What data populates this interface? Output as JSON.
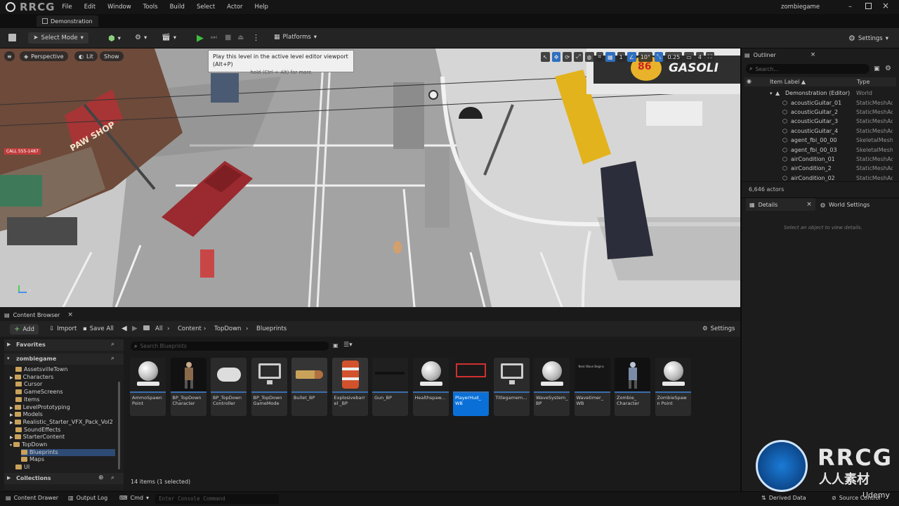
{
  "app": {
    "brand": "RRCG",
    "project": "zombiegame",
    "level": "Demonstration"
  },
  "menu": [
    "File",
    "Edit",
    "Window",
    "Tools",
    "Build",
    "Select",
    "Actor",
    "Help"
  ],
  "toolbar": {
    "select_mode": "Select Mode",
    "platforms": "Platforms",
    "settings": "Settings"
  },
  "viewport": {
    "perspective": "Perspective",
    "lit": "Lit",
    "show": "Show",
    "grid_snap": "1",
    "rot_snap": "10°",
    "scale_snap": "0.25",
    "cam_speed": "4",
    "tooltip_title": "Play this level in the active level editor viewport (Alt+P)",
    "tooltip_hint": "hold (Ctrl + Alt) for more",
    "sign_paw": "PAW SHOP",
    "sign_gas": "GASOLI",
    "sign_86": "86",
    "sign_call": "CALL 555-1487"
  },
  "outliner": {
    "tab": "Outliner",
    "search_placeholder": "Search...",
    "col_label": "Item Label ▲",
    "col_type": "Type",
    "root_label": "Demonstration (Editor)",
    "root_type": "World",
    "rows": [
      {
        "label": "acousticGuitar_01",
        "type": "StaticMeshActor"
      },
      {
        "label": "acousticGuitar_2",
        "type": "StaticMeshActor"
      },
      {
        "label": "acousticGuitar_3",
        "type": "StaticMeshActor"
      },
      {
        "label": "acousticGuitar_4",
        "type": "StaticMeshActor"
      },
      {
        "label": "agent_fbi_00_00",
        "type": "SkeletalMeshActor"
      },
      {
        "label": "agent_fbi_00_03",
        "type": "SkeletalMeshActor"
      },
      {
        "label": "airCondition_01",
        "type": "StaticMeshActor"
      },
      {
        "label": "airCondition_2",
        "type": "StaticMeshActor"
      },
      {
        "label": "airCondition_02",
        "type": "StaticMeshActor"
      }
    ],
    "actor_count": "6,646 actors"
  },
  "details": {
    "tab": "Details",
    "world_settings": "World Settings",
    "empty": "Select an object to view details."
  },
  "content_browser": {
    "tab": "Content Browser",
    "add": "Add",
    "import": "Import",
    "save_all": "Save All",
    "path": [
      "All",
      "Content",
      "TopDown",
      "Blueprints"
    ],
    "settings": "Settings",
    "favorites": "Favorites",
    "root": "zombiegame",
    "folders": [
      "AssetsvilleTown",
      "Characters",
      "Cursor",
      "GameScreens",
      "Items",
      "LevelPrototyping",
      "Models",
      "Realistic_Starter_VFX_Pack_Vol2",
      "SoundEffects",
      "StarterContent",
      "TopDown",
      "Blueprints",
      "Maps",
      "UI"
    ],
    "collections": "Collections",
    "search_placeholder": "Search Blueprints",
    "assets": [
      {
        "name": "AmmoSpawn Point"
      },
      {
        "name": "BP_TopDown Character"
      },
      {
        "name": "BP_TopDown Controller"
      },
      {
        "name": "BP_TopDown GameMode"
      },
      {
        "name": "Bullet_BP"
      },
      {
        "name": "Explosivebarrel _BP"
      },
      {
        "name": "Gun_BP"
      },
      {
        "name": "Healthspaw..."
      },
      {
        "name": "PlayerHud_ WB"
      },
      {
        "name": "Titlegamem..."
      },
      {
        "name": "WaveSystem_ BP"
      },
      {
        "name": "Wavetimer_ WB"
      },
      {
        "name": "Zombie_ Character"
      },
      {
        "name": "ZombieSpawn Point"
      }
    ],
    "wavetimer_caption": "Next Wave Begins",
    "item_count": "14 items (1 selected)"
  },
  "statusbar": {
    "drawer": "Content Drawer",
    "output": "Output Log",
    "cmd": "Cmd",
    "console_placeholder": "Enter Console Command",
    "derived": "Derived Data",
    "source": "Source Control"
  },
  "watermark": {
    "big": "RRCG",
    "cn": "人人素材",
    "udemy": "Udemy"
  }
}
